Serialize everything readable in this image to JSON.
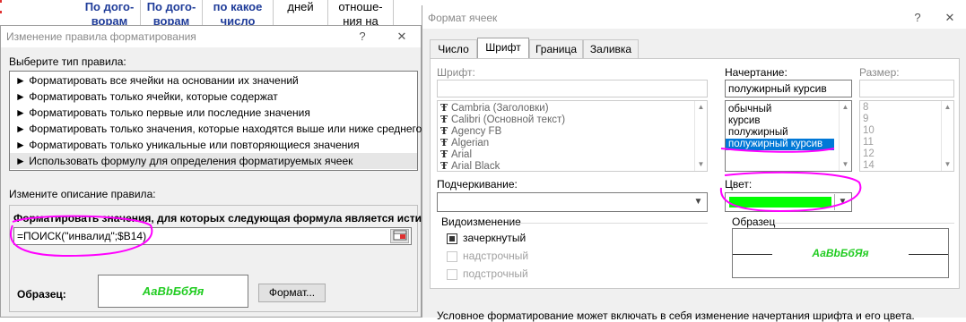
{
  "sheet": {
    "headers": [
      "По дого-",
      "По дого-",
      "по какое",
      "дней",
      "отноше-"
    ],
    "headers_line2": [
      "ворам",
      "ворам",
      "число",
      "",
      "ния на"
    ]
  },
  "dialog1": {
    "title": "Изменение правила форматирования",
    "help_button": "?",
    "close_button": "✕",
    "select_rule_type_label": "Выберите тип правила:",
    "rules": [
      "Форматировать все ячейки на основании их значений",
      "Форматировать только ячейки, которые содержат",
      "Форматировать только первые или последние значения",
      "Форматировать только значения, которые находятся выше или ниже среднего",
      "Форматировать только уникальные или повторяющиеся значения",
      "Использовать формулу для определения форматируемых ячеек"
    ],
    "rule_bullet": "►",
    "edit_description_label": "Измените описание правила:",
    "formula_label": "Форматировать значения, для которых следующая формула является истинной:",
    "formula_value": "=ПОИСК(\"инвалид\";$B14)",
    "sample_label": "Образец:",
    "sample_text": "АаBbБбЯя",
    "format_button": "Формат..."
  },
  "dialog2": {
    "title": "Формат ячеек",
    "help_button": "?",
    "close_button": "✕",
    "tabs": [
      "Число",
      "Шрифт",
      "Граница",
      "Заливка"
    ],
    "active_tab": "Шрифт",
    "font_label": "Шрифт:",
    "font_value": "",
    "fonts": [
      "Cambria (Заголовки)",
      "Calibri (Основной текст)",
      "Agency FB",
      "Algerian",
      "Arial",
      "Arial Black"
    ],
    "style_label": "Начертание:",
    "style_value": "полужирный курсив",
    "styles": [
      "обычный",
      "курсив",
      "полужирный",
      "полужирный курсив"
    ],
    "selected_style": "полужирный курсив",
    "size_label": "Размер:",
    "size_value": "",
    "sizes": [
      "8",
      "9",
      "10",
      "11",
      "12",
      "14"
    ],
    "underline_label": "Подчеркивание:",
    "underline_value": "",
    "color_label": "Цвет:",
    "color_value": "#00ff00",
    "effects_label": "Видоизменение",
    "effects": [
      {
        "label": "зачеркнутый",
        "checked": true,
        "enabled": true
      },
      {
        "label": "надстрочный",
        "checked": false,
        "enabled": false
      },
      {
        "label": "подстрочный",
        "checked": false,
        "enabled": false
      }
    ],
    "sample_label": "Образец",
    "sample_text": "АаBbБбЯя",
    "footer_text": "Условное форматирование может включать в себя изменение начертания шрифта и его цвета."
  },
  "colors": {
    "highlight": "#0078d7",
    "sample_text": "#22cc22",
    "annotation": "#ff00ff",
    "header_text": "#1f3c99"
  }
}
